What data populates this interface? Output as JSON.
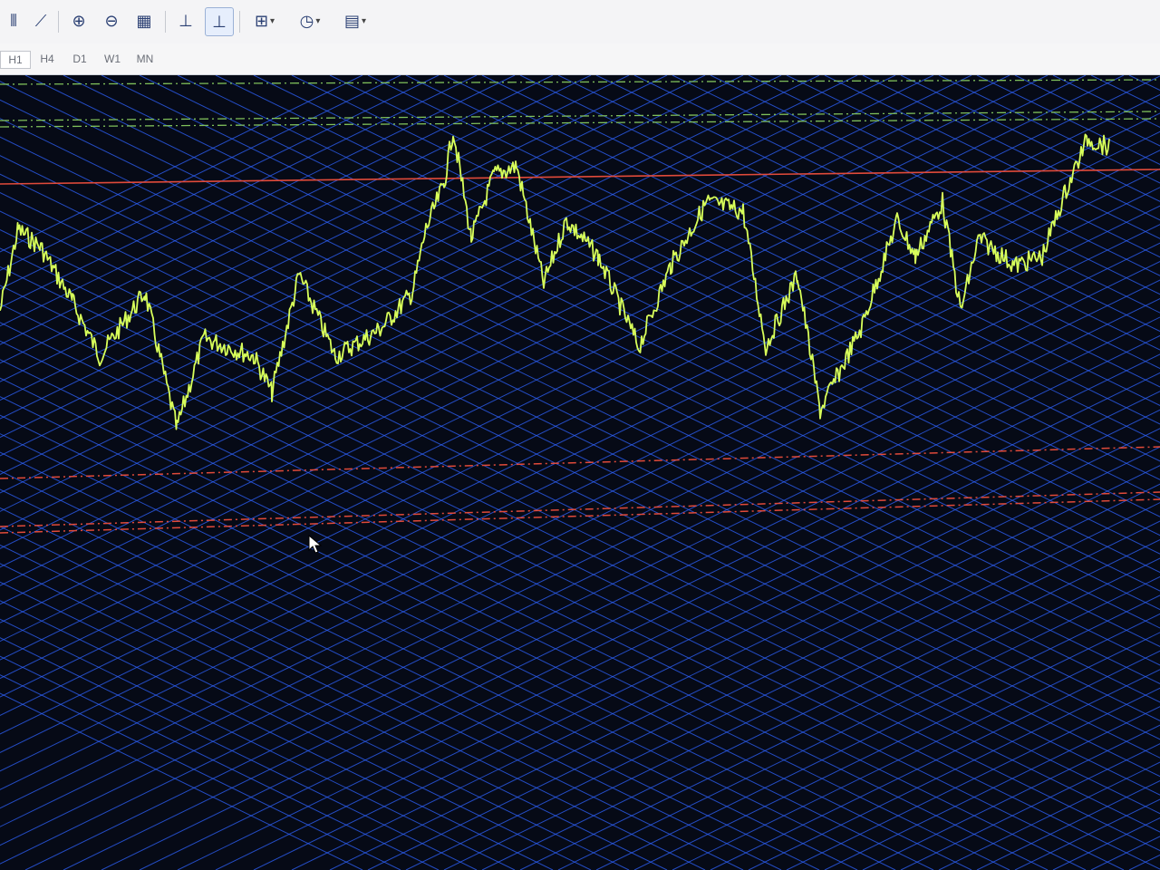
{
  "toolbar": {
    "buttons": [
      {
        "name": "bar-chart-button",
        "icon": "bar-chart-icon",
        "glyph": "⫴"
      },
      {
        "name": "line-chart-button",
        "icon": "line-chart-icon",
        "glyph": "⟋"
      },
      {
        "name": "zoom-in-button",
        "icon": "zoom-in-icon",
        "glyph": "⊕"
      },
      {
        "name": "zoom-out-button",
        "icon": "zoom-out-icon",
        "glyph": "⊖"
      },
      {
        "name": "tile-windows-button",
        "icon": "grid-icon",
        "glyph": "▦"
      },
      {
        "name": "chart-shift-button",
        "icon": "chart-shift-icon",
        "glyph": "⊥"
      },
      {
        "name": "autoscroll-button",
        "icon": "autoscroll-icon",
        "glyph": "⊥"
      },
      {
        "name": "indicators-button",
        "icon": "add-indicator-icon",
        "glyph": "⊞"
      },
      {
        "name": "periods-button",
        "icon": "clock-icon",
        "glyph": "◷"
      },
      {
        "name": "templates-button",
        "icon": "template-icon",
        "glyph": "▤"
      }
    ]
  },
  "timeframes": [
    "H1",
    "H4",
    "D1",
    "W1",
    "MN"
  ],
  "colors": {
    "chart_bg": "#060a16",
    "grid": "#2f63ff",
    "price_line": "#d8ff5a",
    "resistance": "#e04a3a",
    "green_dashed": "#7fbf5a"
  }
}
